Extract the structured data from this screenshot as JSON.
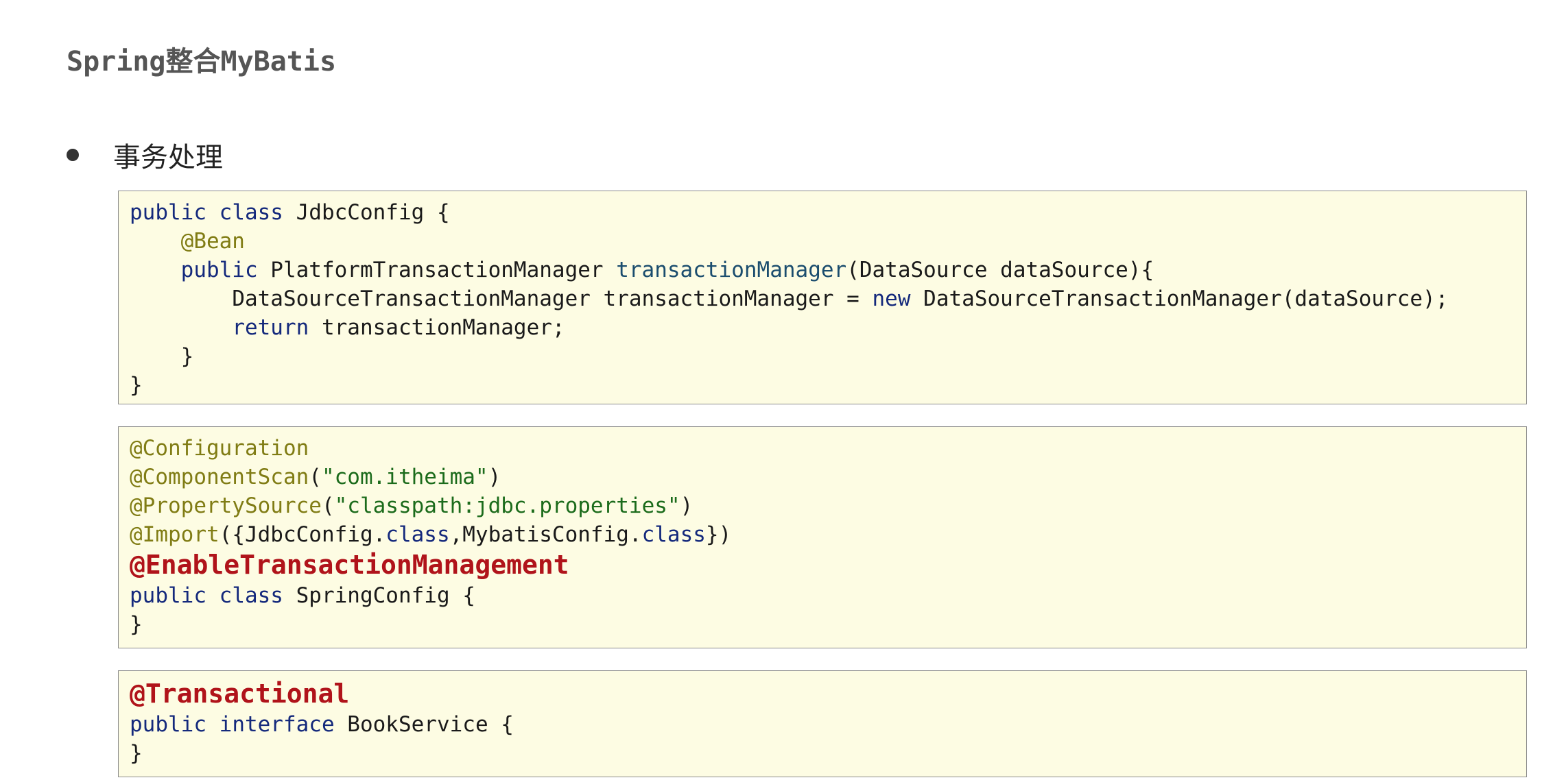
{
  "page": {
    "title": "Spring整合MyBatis",
    "bullet": "事务处理"
  },
  "code_blocks": [
    {
      "lines": [
        {
          "indent": "",
          "tokens": [
            {
              "t": "public",
              "k": "kw"
            },
            {
              "t": " "
            },
            {
              "t": "class",
              "k": "kw"
            },
            {
              "t": " JdbcConfig {"
            }
          ]
        },
        {
          "indent": "    ",
          "tokens": [
            {
              "t": "@Bean",
              "k": "ann"
            }
          ]
        },
        {
          "indent": "    ",
          "tokens": [
            {
              "t": "public",
              "k": "kw"
            },
            {
              "t": " PlatformTransactionManager "
            },
            {
              "t": "transactionManager",
              "k": "mth"
            },
            {
              "t": "(DataSource dataSource){"
            }
          ]
        },
        {
          "indent": "        ",
          "tokens": [
            {
              "t": "DataSourceTransactionManager transactionManager = "
            },
            {
              "t": "new",
              "k": "kw"
            },
            {
              "t": " DataSourceTransactionManager(dataSource);"
            }
          ]
        },
        {
          "indent": "        ",
          "tokens": [
            {
              "t": "return",
              "k": "kw"
            },
            {
              "t": " transactionManager;"
            }
          ]
        },
        {
          "indent": "    ",
          "tokens": [
            {
              "t": "}"
            }
          ]
        },
        {
          "indent": "",
          "tokens": [
            {
              "t": "}"
            }
          ]
        }
      ]
    },
    {
      "lines": [
        {
          "indent": "",
          "tokens": [
            {
              "t": "@Configuration",
              "k": "ann"
            }
          ]
        },
        {
          "indent": "",
          "tokens": [
            {
              "t": "@ComponentScan",
              "k": "ann"
            },
            {
              "t": "("
            },
            {
              "t": "\"com.itheima\"",
              "k": "str"
            },
            {
              "t": ")"
            }
          ]
        },
        {
          "indent": "",
          "tokens": [
            {
              "t": "@PropertySource",
              "k": "ann"
            },
            {
              "t": "("
            },
            {
              "t": "\"classpath:jdbc.properties\"",
              "k": "str"
            },
            {
              "t": ")"
            }
          ]
        },
        {
          "indent": "",
          "tokens": [
            {
              "t": "@Import",
              "k": "ann"
            },
            {
              "t": "({JdbcConfig."
            },
            {
              "t": "class",
              "k": "kw"
            },
            {
              "t": ",MybatisConfig."
            },
            {
              "t": "class",
              "k": "kw"
            },
            {
              "t": "})"
            }
          ]
        },
        {
          "indent": "",
          "big": true,
          "tokens": [
            {
              "t": "@EnableTransactionManagement",
              "k": "big-ann"
            }
          ]
        },
        {
          "indent": "",
          "tokens": [
            {
              "t": "public",
              "k": "kw"
            },
            {
              "t": " "
            },
            {
              "t": "class",
              "k": "kw"
            },
            {
              "t": " SpringConfig {"
            }
          ]
        },
        {
          "indent": "",
          "tokens": [
            {
              "t": "}"
            }
          ]
        }
      ]
    },
    {
      "lines": [
        {
          "indent": "",
          "big": true,
          "tokens": [
            {
              "t": "@Transactional",
              "k": "big-ann"
            }
          ]
        },
        {
          "indent": "",
          "tokens": [
            {
              "t": "public",
              "k": "kw"
            },
            {
              "t": " "
            },
            {
              "t": "interface",
              "k": "kw"
            },
            {
              "t": " BookService {"
            }
          ]
        },
        {
          "indent": "",
          "tokens": [
            {
              "t": "}"
            }
          ]
        }
      ]
    }
  ]
}
